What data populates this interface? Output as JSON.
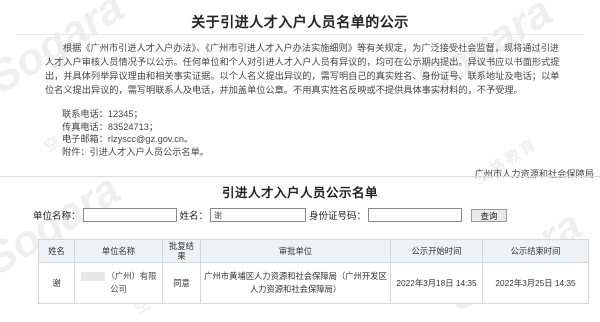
{
  "page": {
    "title": "关于引进人才入户人员名单的公示",
    "notice_paragraph": "根据《广州市引进人才入户办法》、《广州市引进人才入户办法实施细则》等有关规定，为广泛接受社会监督，现将通过引进人才入户审核人员情况予以公示。任何单位和个人对引进人才入户人员有异议的，均可在公示期内提出。异议书应以书面形式提出，并具体列举异议理由和相关事实证据。以个人名义提出异议的，需写明自己的真实姓名、身份证号、联系地址及电话；以单位名义提出异议的，需写明联系人及电话，并加盖单位公章。不用真实姓名反映或不提供具体事实材料的，不予受理。",
    "contact": {
      "phone": "联系电话：12345；",
      "fax": "传真电话：83524713；",
      "email": "电子邮箱：rlzyscc@gz.gov.cn。",
      "attachment": "附件：引进人才入户人员公示名单。"
    },
    "bureau": "广州市人力资源和社会保障局"
  },
  "list": {
    "title": "引进人才入户人员公示名单"
  },
  "search": {
    "unit_label": "单位名称：",
    "unit_value": "",
    "name_label": "姓名：",
    "name_value": "谢",
    "id_label": "身份证号码：",
    "id_value": "",
    "button_label": "查询"
  },
  "table": {
    "columns": [
      "姓名",
      "单位名称",
      "批复结果",
      "审批单位",
      "公示开始时间",
      "公示结束时间"
    ],
    "rows": [
      {
        "name": "谢",
        "unit": "（广州）有限公司",
        "result": "同意",
        "approver": "广州市黄埔区人力资源和社会保障局（广州开发区人力资源和社会保障局）",
        "start": "2022年3月18日 14:35",
        "end": "2022年3月25日 14:35"
      }
    ]
  },
  "watermark": {
    "brand": "Sogara",
    "chinese": "空格教育"
  }
}
